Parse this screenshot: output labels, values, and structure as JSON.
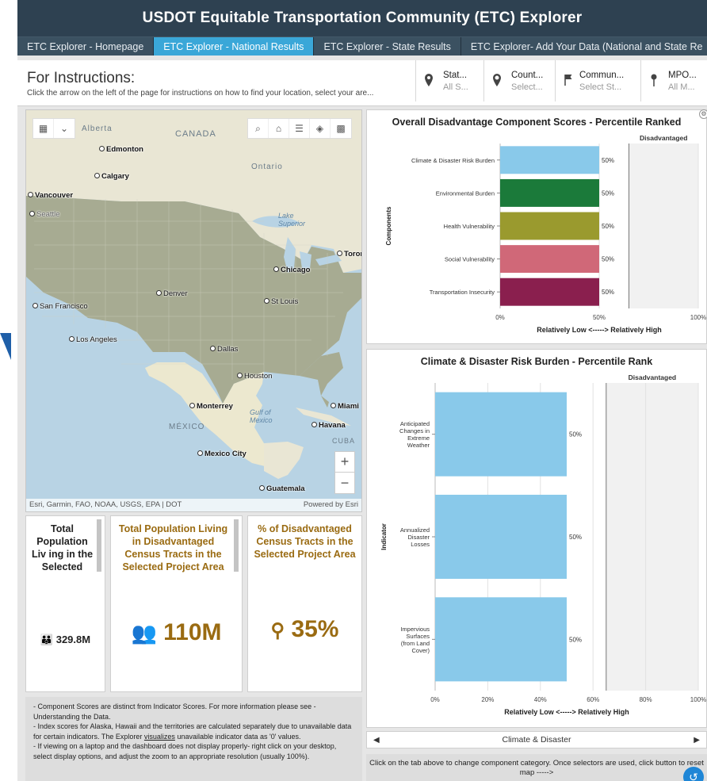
{
  "title": "USDOT Equitable Transportation Community (ETC) Explorer",
  "tabs": [
    {
      "label": "ETC Explorer - Homepage"
    },
    {
      "label": "ETC Explorer - National Results"
    },
    {
      "label": "ETC Explorer - State Results"
    },
    {
      "label": "ETC Explorer- Add Your Data (National and State Re"
    }
  ],
  "instructions": {
    "title": "For Instructions:",
    "text": "Click the arrow on the left of the page for instructions on how to find your location, select your are..."
  },
  "selectors": [
    {
      "title": "Stat...",
      "value": "All S...",
      "icon": "location-pin-icon"
    },
    {
      "title": "Count...",
      "value": "Select...",
      "icon": "location-marker-icon"
    },
    {
      "title": "Commun...",
      "value": "Select St...",
      "icon": "flag-icon"
    },
    {
      "title": "MPO...",
      "value": "All M...",
      "icon": "pushpin-icon"
    }
  ],
  "map": {
    "attribution": "Esri, Garmin, FAO, NOAA, USGS, EPA | DOT",
    "powered_by": "Powered by Esri",
    "regions": {
      "canada": "CANADA",
      "mexico": "MÉXICO",
      "alberta": "Alberta",
      "ontario": "Ontario",
      "cuba": "CUBA"
    },
    "water": {
      "gulf": "Gulf of Mexico",
      "lake": "Lake Superior"
    },
    "cities": {
      "edmonton": "Edmonton",
      "calgary": "Calgary",
      "vancouver": "Vancouver",
      "seattle": "Seattle",
      "toronto": "Toror",
      "chicago": "Chicago",
      "denver": "Denver",
      "st_louis": "St Louis",
      "san_francisco": "San Francisco",
      "los_angeles": "Los Angeles",
      "dallas": "Dallas",
      "houston": "Houston",
      "monterrey": "Monterrey",
      "miami": "Miami",
      "havana": "Havana",
      "mexico_city": "Mexico City",
      "guatemala": "Guatemala"
    }
  },
  "stats": [
    {
      "title": "Total Population Liv ing in the Selected",
      "value": "329.8M",
      "icon": "people-icon"
    },
    {
      "title": "Total Population Living in Disadvantaged Census Tracts in the Selected Project Area",
      "value": "110M",
      "icon": "group-icon"
    },
    {
      "title": "% of Disadvantaged Census Tracts in the Selected Project Area",
      "value": "35%",
      "icon": "location-search-icon"
    }
  ],
  "notes": [
    "- Component Scores are distinct from Indicator Scores. For more information please see - Understanding the Data.",
    "- Index scores for Alaska, Hawaii and the territories are calculated separately due to unavailable data for certain indicators. The Explorer",
    "visualizes",
    "unavailable indicator data as '0' values.",
    "- If viewing on a laptop and the dashboard does not display properly- right click on your desktop, select display options, and adjust the zoom to an appropriate resolution (usually 100%)."
  ],
  "chart_data": [
    {
      "type": "bar",
      "orientation": "horizontal",
      "title": "Overall Disadvantage Component Scores - Percentile Ranked",
      "ylabel": "Components",
      "xlabel": "Relatively Low <-----> Relatively High",
      "threshold_label": "Disadvantaged",
      "threshold": 65,
      "categories": [
        "Climate & Disaster Risk Burden",
        "Environmental Burden",
        "Health Vulnerability",
        "Social Vulnerability",
        "Transportation Insecurity"
      ],
      "values": [
        50,
        50,
        50,
        50,
        50
      ],
      "value_labels": [
        "50%",
        "50%",
        "50%",
        "50%",
        "50%"
      ],
      "colors": [
        "#89c9ea",
        "#1b7a3a",
        "#9a9a2e",
        "#d06878",
        "#8a1f4e"
      ],
      "xticks": [
        "0%",
        "50%",
        "100%"
      ],
      "xlim": [
        0,
        100
      ]
    },
    {
      "type": "bar",
      "orientation": "horizontal",
      "title": "Climate & Disaster Risk Burden - Percentile Rank",
      "ylabel": "Indicator",
      "xlabel": "Relatively Low <-----> Relatively High",
      "threshold_label": "Disadvantaged",
      "threshold": 65,
      "categories": [
        [
          "Anticipated",
          "Changes in",
          "Extreme",
          "Weather"
        ],
        [
          "Annualized",
          "Disaster",
          "Losses"
        ],
        [
          "Impervious",
          "Surfaces",
          "(from Land",
          "Cover)"
        ]
      ],
      "values": [
        50,
        50,
        50
      ],
      "value_labels": [
        "50%",
        "50%",
        "50%"
      ],
      "colors": [
        "#89c9ea",
        "#89c9ea",
        "#89c9ea"
      ],
      "xticks": [
        "0%",
        "20%",
        "40%",
        "60%",
        "80%",
        "100%"
      ],
      "xlim": [
        0,
        100
      ]
    }
  ],
  "pager": {
    "label": "Climate & Disaster"
  },
  "footer": "Click on the tab above to change component category. Once selectors are used, click button to reset map ----->"
}
